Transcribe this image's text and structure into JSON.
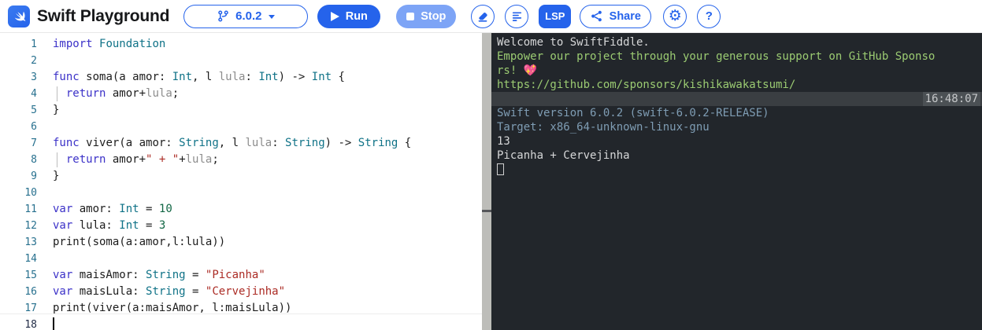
{
  "header": {
    "title": "Swift Playground",
    "version": "6.0.2",
    "run_label": "Run",
    "stop_label": "Stop",
    "lsp_label": "LSP",
    "share_label": "Share",
    "help_label": "?",
    "settings_glyph": "⚙",
    "colors": {
      "accent": "#2563eb",
      "stop_bg": "#7da4f6",
      "logo_bg": "#2e6ceb"
    }
  },
  "editor": {
    "colors": {
      "keyword": "#3b31c8",
      "type": "#0f7287",
      "string": "#ab2b24",
      "number": "#116644",
      "dim": "#8c8c8c",
      "plain": "#1c1c1c",
      "line_number": "#27708e",
      "active_line_number": "#1f2a44"
    },
    "lines": [
      {
        "n": 1,
        "tokens": [
          [
            "import ",
            "kw"
          ],
          [
            "Foundation",
            "type"
          ]
        ]
      },
      {
        "n": 2,
        "tokens": []
      },
      {
        "n": 3,
        "tokens": [
          [
            "func ",
            "kw"
          ],
          [
            "soma(a amor: ",
            "pl"
          ],
          [
            "Int",
            "type"
          ],
          [
            ", l ",
            "pl"
          ],
          [
            "lula",
            "dim"
          ],
          [
            ": ",
            "pl"
          ],
          [
            "Int",
            "type"
          ],
          [
            ") -> ",
            "pl"
          ],
          [
            "Int",
            "type"
          ],
          [
            " {",
            "pl"
          ]
        ]
      },
      {
        "n": 4,
        "guide": true,
        "tokens": [
          [
            "  ",
            "pl"
          ],
          [
            "return ",
            "kw"
          ],
          [
            "amor+",
            "pl"
          ],
          [
            "lula",
            "dim"
          ],
          [
            ";",
            "pl"
          ]
        ]
      },
      {
        "n": 5,
        "tokens": [
          [
            "}",
            "pl"
          ]
        ]
      },
      {
        "n": 6,
        "tokens": []
      },
      {
        "n": 7,
        "tokens": [
          [
            "func ",
            "kw"
          ],
          [
            "viver(a amor: ",
            "pl"
          ],
          [
            "String",
            "type"
          ],
          [
            ", l ",
            "pl"
          ],
          [
            "lula",
            "dim"
          ],
          [
            ": ",
            "pl"
          ],
          [
            "String",
            "type"
          ],
          [
            ") -> ",
            "pl"
          ],
          [
            "String",
            "type"
          ],
          [
            " {",
            "pl"
          ]
        ]
      },
      {
        "n": 8,
        "guide": true,
        "tokens": [
          [
            "  ",
            "pl"
          ],
          [
            "return ",
            "kw"
          ],
          [
            "amor+",
            "pl"
          ],
          [
            "\" + \"",
            "str"
          ],
          [
            "+",
            "pl"
          ],
          [
            "lula",
            "dim"
          ],
          [
            ";",
            "pl"
          ]
        ]
      },
      {
        "n": 9,
        "tokens": [
          [
            "}",
            "pl"
          ]
        ]
      },
      {
        "n": 10,
        "tokens": []
      },
      {
        "n": 11,
        "tokens": [
          [
            "var ",
            "kw"
          ],
          [
            "amor: ",
            "pl"
          ],
          [
            "Int",
            "type"
          ],
          [
            " = ",
            "pl"
          ],
          [
            "10",
            "num"
          ]
        ]
      },
      {
        "n": 12,
        "tokens": [
          [
            "var ",
            "kw"
          ],
          [
            "lula: ",
            "pl"
          ],
          [
            "Int",
            "type"
          ],
          [
            " = ",
            "pl"
          ],
          [
            "3",
            "num"
          ]
        ]
      },
      {
        "n": 13,
        "tokens": [
          [
            "print(soma(a:amor,l:lula))",
            "pl"
          ]
        ]
      },
      {
        "n": 14,
        "tokens": []
      },
      {
        "n": 15,
        "tokens": [
          [
            "var ",
            "kw"
          ],
          [
            "maisAmor: ",
            "pl"
          ],
          [
            "String",
            "type"
          ],
          [
            " = ",
            "pl"
          ],
          [
            "\"Picanha\"",
            "str"
          ]
        ]
      },
      {
        "n": 16,
        "tokens": [
          [
            "var ",
            "kw"
          ],
          [
            "maisLula: ",
            "pl"
          ],
          [
            "String",
            "type"
          ],
          [
            " = ",
            "pl"
          ],
          [
            "\"Cervejinha\"",
            "str"
          ]
        ]
      },
      {
        "n": 17,
        "tokens": [
          [
            "print(viver(a:maisAmor, l:maisLula))",
            "pl"
          ]
        ]
      },
      {
        "n": 18,
        "cursor": true,
        "active": true,
        "tokens": []
      }
    ]
  },
  "terminal": {
    "colors": {
      "bg": "#22262b",
      "text": "#d6d7d8",
      "green": "#9bcb72",
      "slate": "#7f9db4",
      "bar_bg": "#3a3e42",
      "time_bg": "#4b5054",
      "time_text": "#c6c8ca"
    },
    "lines": [
      {
        "text": "Welcome to SwiftFiddle.",
        "color": "white"
      },
      {
        "text": "Empower our project through your generous support on GitHub Sponso",
        "color": "green"
      },
      {
        "text": "rs! 💖",
        "color": "green"
      },
      {
        "text": "https://github.com/sponsors/kishikawakatsumi/",
        "color": "green"
      },
      {
        "type": "bar",
        "time": "16:48:07"
      },
      {
        "text": "Swift version 6.0.2 (swift-6.0.2-RELEASE)",
        "color": "slate"
      },
      {
        "text": "Target: x86_64-unknown-linux-gnu",
        "color": "slate"
      },
      {
        "text": "13",
        "color": "white"
      },
      {
        "text": "Picanha + Cervejinha",
        "color": "white"
      },
      {
        "type": "cursor"
      }
    ]
  }
}
